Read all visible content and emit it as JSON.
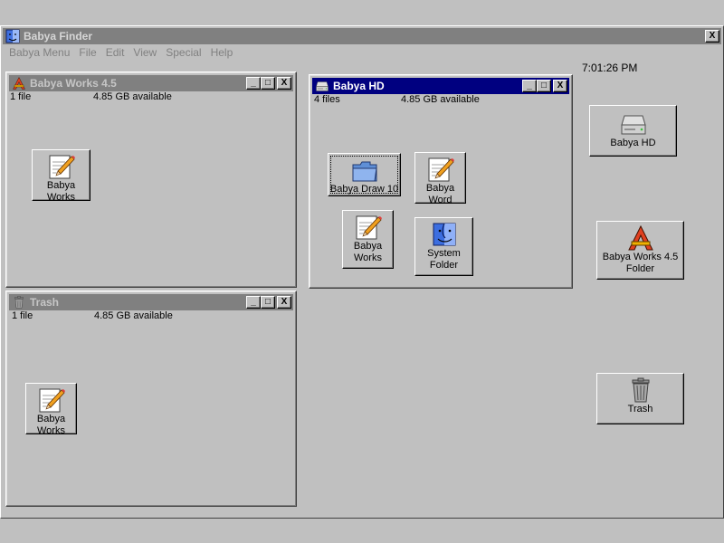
{
  "finder": {
    "title": "Babya Finder",
    "menus": [
      "Babya Menu",
      "File",
      "Edit",
      "View",
      "Special",
      "Help"
    ],
    "close_label": "X"
  },
  "clock": "7:01:26 PM",
  "windows": {
    "works": {
      "title": "Babya Works 4.5",
      "file_count": "1 file",
      "available": "4.85 GB available",
      "icons": [
        {
          "label": "Babya\nWorks"
        }
      ]
    },
    "trash": {
      "title": "Trash",
      "file_count": "1 file",
      "available": "4.85 GB available",
      "icons": [
        {
          "label": "Babya\nWorks"
        }
      ]
    },
    "hd": {
      "title": "Babya HD",
      "file_count": "4 files",
      "available": "4.85 GB  available",
      "icons": [
        {
          "label": "Babya Draw 10"
        },
        {
          "label": "Babya\nWord"
        },
        {
          "label": "Babya\nWorks"
        },
        {
          "label": "System\nFolder"
        }
      ]
    }
  },
  "desktop": {
    "icons": [
      {
        "label": "Babya HD"
      },
      {
        "label": "Babya Works 4.5\nFolder"
      },
      {
        "label": "Trash"
      }
    ]
  },
  "window_buttons": {
    "minimize": "_",
    "maximize": "□",
    "close": "X"
  },
  "colors": {
    "desktop": "#c0c0c0",
    "active_title": "#000080",
    "inactive_title": "#808080"
  }
}
